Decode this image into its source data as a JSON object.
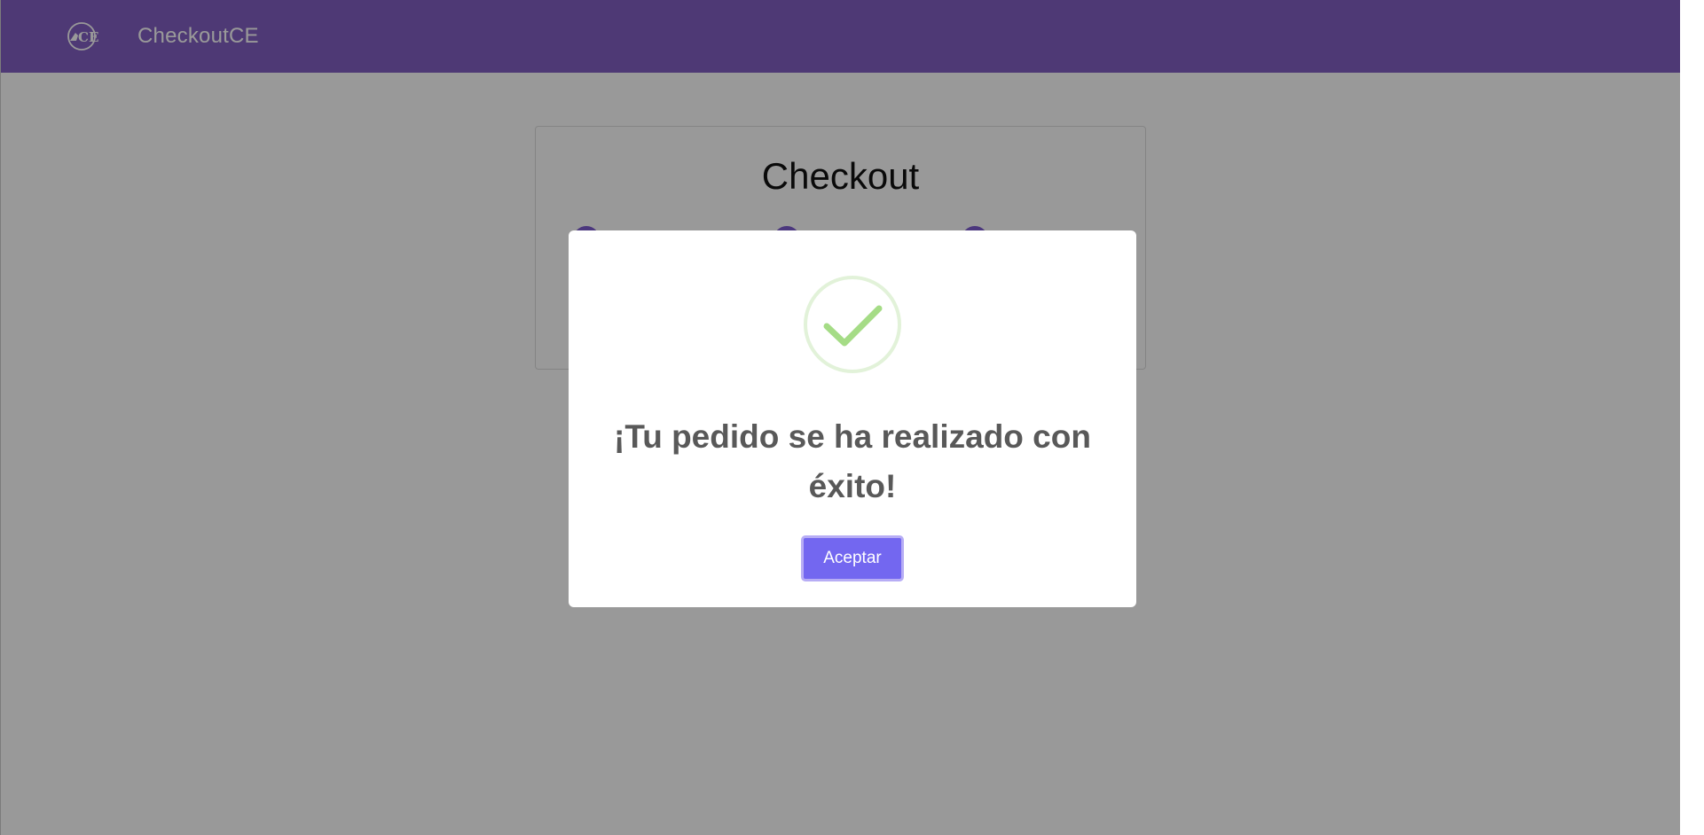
{
  "app": {
    "brand": "CheckoutCE",
    "logo_text": "CE"
  },
  "checkout": {
    "title": "Checkout",
    "step_count": 3
  },
  "modal": {
    "icon": "success-check-icon",
    "title": "¡Tu pedido se ha realizado con éxito!",
    "confirm_label": "Aceptar"
  },
  "colors": {
    "navbar": "#8360c3",
    "overlay": "rgba(0,0,0,0.4)",
    "button": "#7367f0",
    "success": "#a5dc86"
  }
}
